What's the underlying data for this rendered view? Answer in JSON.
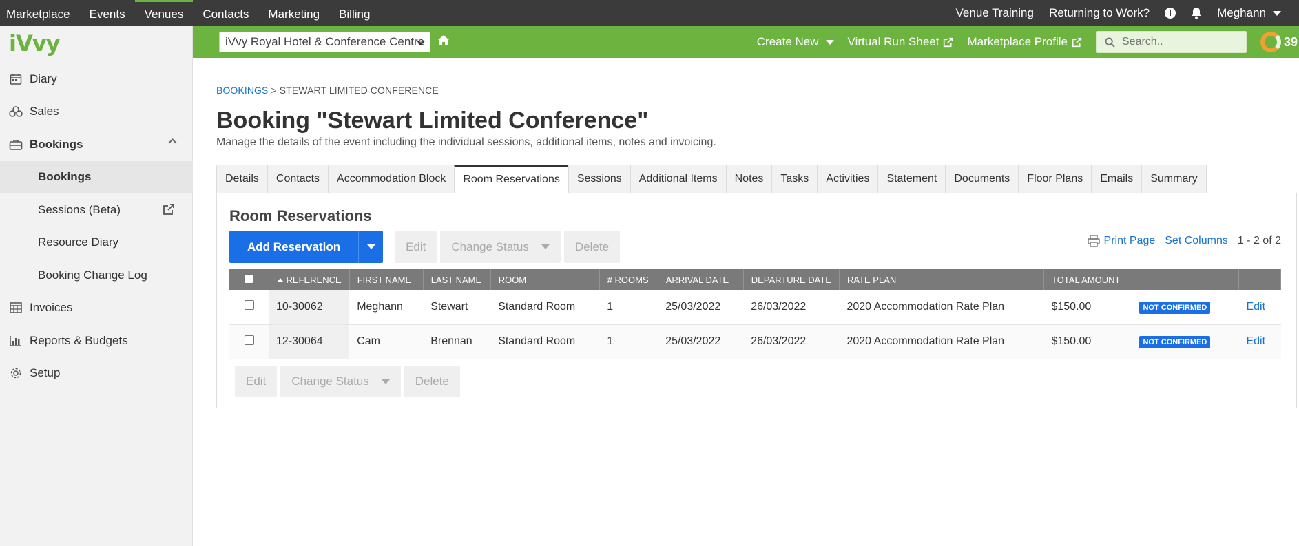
{
  "topbar": {
    "nav": [
      "Marketplace",
      "Events",
      "Venues",
      "Contacts",
      "Marketing",
      "Billing"
    ],
    "active_nav": "Venues",
    "venue_training": "Venue Training",
    "returning": "Returning to Work?",
    "user": "Meghann"
  },
  "sidebar": {
    "logo": "iVvy",
    "items": [
      {
        "label": "Diary",
        "icon": "calendar-icon"
      },
      {
        "label": "Sales",
        "icon": "sales-icon"
      },
      {
        "label": "Bookings",
        "icon": "briefcase-icon"
      },
      {
        "label": "Bookings"
      },
      {
        "label": "Sessions (Beta)"
      },
      {
        "label": "Resource Diary"
      },
      {
        "label": "Booking Change Log"
      },
      {
        "label": "Invoices",
        "icon": "table-icon"
      },
      {
        "label": "Reports & Budgets",
        "icon": "bar-chart-icon"
      },
      {
        "label": "Setup",
        "icon": "gear-icon"
      }
    ]
  },
  "greenbar": {
    "venue": "iVvy Royal Hotel & Conference Centre",
    "create_new": "Create New",
    "virtual_run_sheet": "Virtual Run Sheet",
    "marketplace_profile": "Marketplace Profile",
    "search_placeholder": "Search..",
    "counter": "39"
  },
  "page": {
    "breadcrumb_root": "BOOKINGS",
    "breadcrumb_sep": ">",
    "breadcrumb_current": "STEWART LIMITED CONFERENCE",
    "title": "Booking \"Stewart Limited Conference\"",
    "subtitle": "Manage the details of the event including the individual sessions, additional items, notes and invoicing.",
    "tabs": [
      "Details",
      "Contacts",
      "Accommodation Block",
      "Room Reservations",
      "Sessions",
      "Additional Items",
      "Notes",
      "Tasks",
      "Activities",
      "Statement",
      "Documents",
      "Floor Plans",
      "Emails",
      "Summary"
    ],
    "active_tab": "Room Reservations"
  },
  "panel": {
    "title": "Room Reservations",
    "add_reservation": "Add Reservation",
    "edit": "Edit",
    "change_status": "Change Status",
    "delete": "Delete",
    "print_page": "Print Page",
    "set_columns": "Set Columns",
    "count": "1 - 2 of 2",
    "columns": [
      "REFERENCE",
      "FIRST NAME",
      "LAST NAME",
      "ROOM",
      "# ROOMS",
      "ARRIVAL DATE",
      "DEPARTURE DATE",
      "RATE PLAN",
      "TOTAL AMOUNT"
    ],
    "rows": [
      {
        "reference": "10-30062",
        "first": "Meghann",
        "last": "Stewart",
        "room": "Standard Room",
        "rooms": "1",
        "arrival": "25/03/2022",
        "departure": "26/03/2022",
        "rate_plan": "2020 Accommodation Rate Plan",
        "total": "$150.00",
        "status": "NOT CONFIRMED",
        "action": "Edit"
      },
      {
        "reference": "12-30064",
        "first": "Cam",
        "last": "Brennan",
        "room": "Standard Room",
        "rooms": "1",
        "arrival": "25/03/2022",
        "departure": "26/03/2022",
        "rate_plan": "2020 Accommodation Rate Plan",
        "total": "$150.00",
        "status": "NOT CONFIRMED",
        "action": "Edit"
      }
    ]
  },
  "colors": {
    "green": "#6cb33f",
    "topbar": "#3b3b3b",
    "primary": "#1a6fe6",
    "link": "#1a73c9"
  }
}
